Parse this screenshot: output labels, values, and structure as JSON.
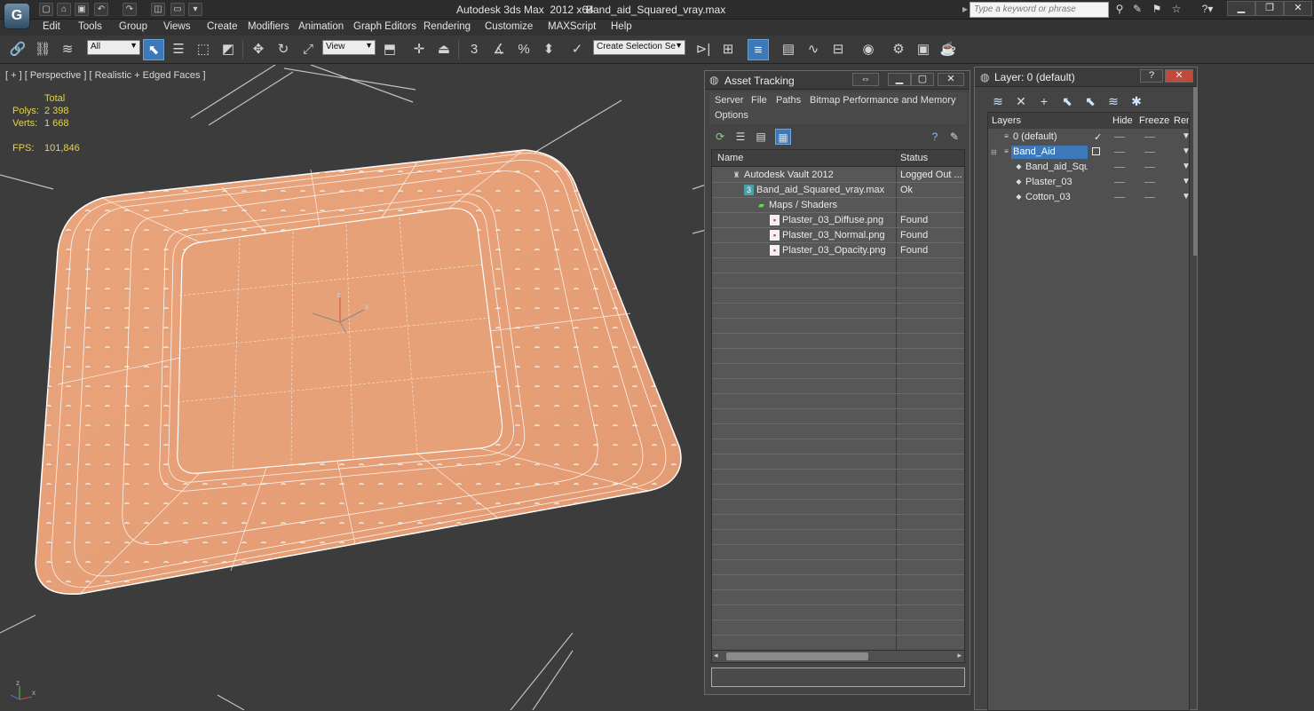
{
  "window": {
    "title_text": "Autodesk 3ds Max  2012 x64",
    "file_name": "Band_aid_Squared_vray.max",
    "search_placeholder": "Type a keyword or phrase",
    "logo_letter": "G"
  },
  "menu": [
    "Edit",
    "Tools",
    "Group",
    "Views",
    "Create",
    "Modifiers",
    "Animation",
    "Graph Editors",
    "Rendering",
    "Customize",
    "MAXScript",
    "Help"
  ],
  "toolbar": {
    "selection_filter": "All",
    "reference_coord": "View",
    "named_selection_placeholder": "Create Selection Se"
  },
  "viewport": {
    "label": "[ + ] [ Perspective ] [ Realistic + Edged Faces ]",
    "stats_header": "Total",
    "polys_label": "Polys:",
    "polys_value": "2 398",
    "verts_label": "Verts:",
    "verts_value": "1 668",
    "fps_label": "FPS:",
    "fps_value": "101,846",
    "gizmo_z": "z",
    "gizmo_x": "x",
    "gizmo_y": "y"
  },
  "asset_tracking": {
    "title": "Asset Tracking",
    "menu": [
      "Server",
      "File",
      "Paths",
      "Bitmap Performance and Memory",
      "Options"
    ],
    "columns": {
      "name": "Name",
      "status": "Status"
    },
    "rows": [
      {
        "name": "Autodesk Vault 2012",
        "status": "Logged Out ..."
      },
      {
        "name": "Band_aid_Squared_vray.max",
        "status": "Ok"
      },
      {
        "name": "Maps / Shaders",
        "status": ""
      },
      {
        "name": "Plaster_03_Diffuse.png",
        "status": "Found"
      },
      {
        "name": "Plaster_03_Normal.png",
        "status": "Found"
      },
      {
        "name": "Plaster_03_Opacity.png",
        "status": "Found"
      }
    ]
  },
  "layer_manager": {
    "title": "Layer: 0 (default)",
    "columns": {
      "layers": "Layers",
      "hide": "Hide",
      "freeze": "Freeze",
      "render": "Ren"
    },
    "rows": [
      {
        "name": "0 (default)",
        "selected": false
      },
      {
        "name": "Band_Aid",
        "selected": true
      },
      {
        "name": "Band_aid_Squared",
        "selected": false
      },
      {
        "name": "Plaster_03",
        "selected": false
      },
      {
        "name": "Cotton_03",
        "selected": false
      }
    ]
  },
  "colors": {
    "viewport_bg": "#3c3c3c",
    "plaster": "#e8a27a",
    "selection_blue": "#3d78b8",
    "stats_yellow": "#e6d24a"
  }
}
